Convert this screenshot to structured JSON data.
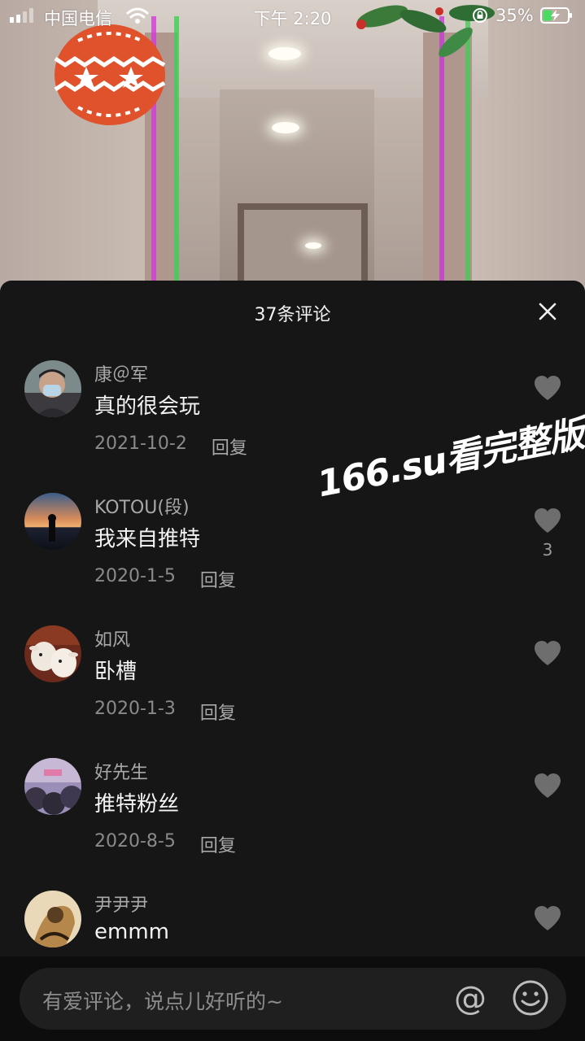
{
  "status_bar": {
    "carrier": "中国电信",
    "time": "下午 2:20",
    "battery_percent": "35%",
    "icons": [
      "signal-icon",
      "wifi-icon",
      "orientation-lock-icon",
      "battery-charging-icon"
    ]
  },
  "comments_panel": {
    "title": "37条评论",
    "close_icon": "close-icon",
    "comments": [
      {
        "username": "康＠军",
        "text": "真的很会玩",
        "date": "2021-10-2",
        "reply_label": "回复",
        "likes": ""
      },
      {
        "username": "KOTOU(段)",
        "text": "我来自推特",
        "date": "2020-1-5",
        "reply_label": "回复",
        "likes": "3"
      },
      {
        "username": "如风",
        "text": "卧槽",
        "date": "2020-1-3",
        "reply_label": "回复",
        "likes": ""
      },
      {
        "username": "好先生",
        "text": "推特粉丝",
        "date": "2020-8-5",
        "reply_label": "回复",
        "likes": ""
      },
      {
        "username": "尹尹尹",
        "text": "emmm",
        "date": "",
        "reply_label": "",
        "likes": ""
      }
    ]
  },
  "watermark": "166.su看完整版",
  "input": {
    "placeholder": "有爱评论，说点儿好听的~",
    "at_label": "@",
    "emoji_icon": "emoji-icon"
  },
  "colors": {
    "sheet_bg": "#161616",
    "input_bar_bg": "#0d0d0d",
    "text_primary": "#f3f3f3",
    "text_secondary": "#a8a8a8"
  }
}
